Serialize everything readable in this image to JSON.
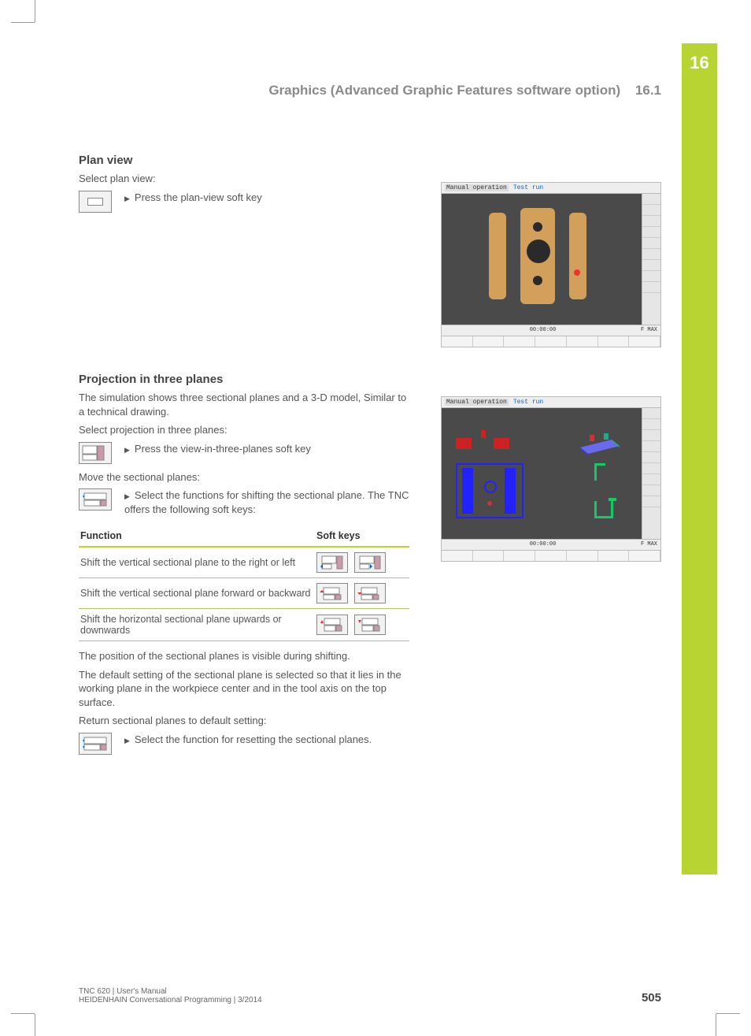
{
  "chapter_number": "16",
  "header": {
    "title": "Graphics (Advanced Graphic Features software option)",
    "section_number": "16.1"
  },
  "plan_view": {
    "heading": "Plan view",
    "intro": "Select plan view:",
    "step1": "Press the plan-view soft key"
  },
  "screenshot_labels": {
    "manual_operation": "Manual operation",
    "test_run": "Test run",
    "status_time": "00:00:00",
    "status_fmax": "F MAX"
  },
  "projection": {
    "heading": "Projection in three planes",
    "p1": "The simulation shows three sectional planes and a 3-D model, Similar to a technical drawing.",
    "p2": "Select projection in three planes:",
    "step1": "Press the view-in-three-planes soft key",
    "p3": "Move the sectional planes:",
    "step2": "Select the functions for shifting the sectional plane. The TNC offers the following soft keys:",
    "table": {
      "head_function": "Function",
      "head_softkeys": "Soft keys",
      "rows": [
        {
          "fn": "Shift the vertical sectional plane to the right or left"
        },
        {
          "fn": "Shift the vertical sectional plane forward or backward"
        },
        {
          "fn": "Shift the horizontal sectional plane upwards or downwards"
        }
      ]
    },
    "p4": "The position of the sectional planes is visible during shifting.",
    "p5": "The default setting of the sectional plane is selected so that it lies in the working plane in the workpiece center and in the tool axis on the top surface.",
    "p6": "Return sectional planes to default setting:",
    "step3": "Select the function for resetting the sectional planes."
  },
  "footer": {
    "line1": "TNC 620 | User's Manual",
    "line2": "HEIDENHAIN Conversational Programming | 3/2014",
    "page": "505"
  }
}
